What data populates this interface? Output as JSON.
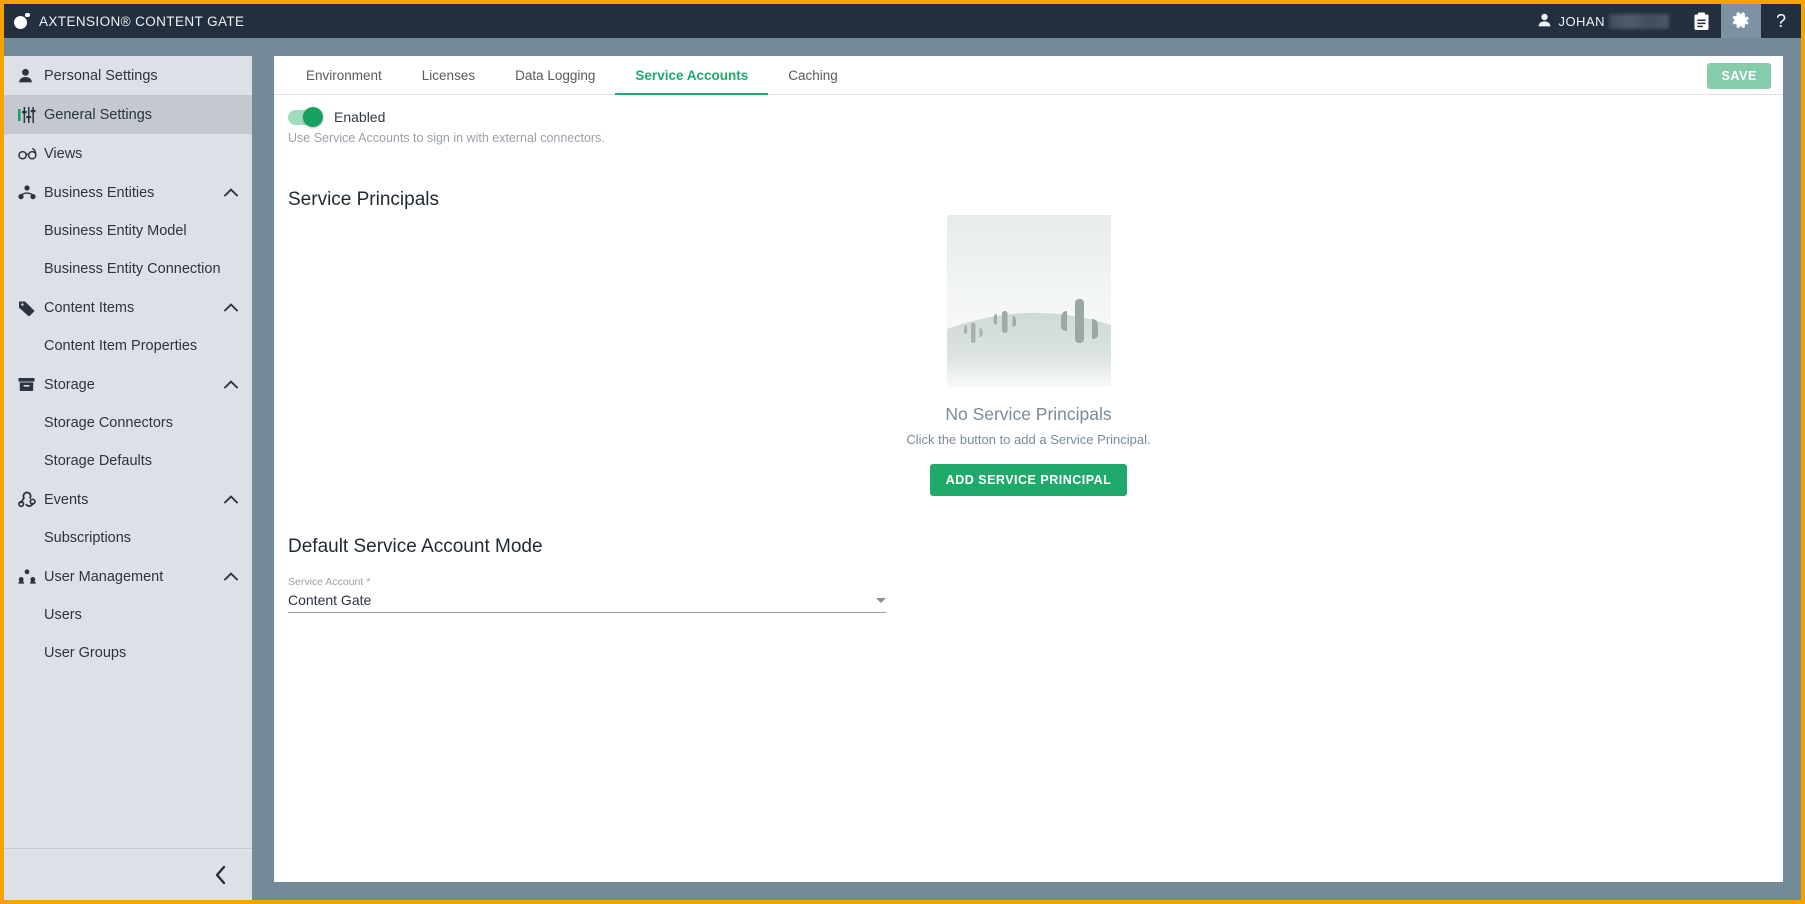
{
  "app": {
    "title": "AXTENSION® CONTENT GATE",
    "brand_icon": "axtension-logo-icon",
    "accent_green": "#1faa6c",
    "topbar_bg": "#232f3e",
    "frame_border": "#F5A300",
    "page_bg": "#738b99"
  },
  "topbar": {
    "user": {
      "icon": "user-icon",
      "name": "JOHAN",
      "name_redacted": true
    },
    "icons": [
      {
        "name": "clipboard-icon",
        "label": "Clipboard"
      },
      {
        "name": "gear-icon",
        "label": "Settings",
        "active": true
      },
      {
        "name": "help-icon",
        "label": "Help"
      }
    ]
  },
  "sidebar": {
    "items": [
      {
        "label": "Personal Settings",
        "icon": "user-icon",
        "type": "item",
        "selected": false,
        "expandable": false
      },
      {
        "label": "General Settings",
        "icon": "sliders-icon",
        "type": "item",
        "selected": true,
        "expandable": false
      },
      {
        "label": "Views",
        "icon": "glasses-icon",
        "type": "item",
        "selected": false,
        "expandable": false
      },
      {
        "label": "Business Entities",
        "icon": "hierarchy-icon",
        "type": "group",
        "expandable": true,
        "expanded": true
      },
      {
        "label": "Business Entity Model",
        "type": "sub"
      },
      {
        "label": "Business Entity Connection",
        "type": "sub"
      },
      {
        "label": "Content Items",
        "icon": "tag-icon",
        "type": "group",
        "expandable": true,
        "expanded": true
      },
      {
        "label": "Content Item Properties",
        "type": "sub"
      },
      {
        "label": "Storage",
        "icon": "archive-icon",
        "type": "group",
        "expandable": true,
        "expanded": true
      },
      {
        "label": "Storage Connectors",
        "type": "sub"
      },
      {
        "label": "Storage Defaults",
        "type": "sub"
      },
      {
        "label": "Events",
        "icon": "webhook-icon",
        "type": "group",
        "expandable": true,
        "expanded": true
      },
      {
        "label": "Subscriptions",
        "type": "sub"
      },
      {
        "label": "User Management",
        "icon": "users-icon",
        "type": "group",
        "expandable": true,
        "expanded": true
      },
      {
        "label": "Users",
        "type": "sub"
      },
      {
        "label": "User Groups",
        "type": "sub"
      }
    ],
    "collapse_icon": "chevron-left-icon"
  },
  "main": {
    "tabs": [
      {
        "label": "Environment",
        "active": false
      },
      {
        "label": "Licenses",
        "active": false
      },
      {
        "label": "Data Logging",
        "active": false
      },
      {
        "label": "Service Accounts",
        "active": true
      },
      {
        "label": "Caching",
        "active": false
      }
    ],
    "save_label": "SAVE",
    "toggle": {
      "label": "Enabled",
      "enabled": true,
      "description": "Use Service Accounts to sign in with external connectors."
    },
    "service_principals": {
      "heading": "Service Principals",
      "empty_illustration": "desert-cactus-illustration",
      "empty_title": "No Service Principals",
      "empty_subtitle": "Click the button to add a Service Principal.",
      "add_button_label": "ADD SERVICE PRINCIPAL"
    },
    "default_mode": {
      "heading": "Default Service Account Mode",
      "field_label": "Service Account *",
      "field_value": "Content Gate",
      "dropdown_icon": "chevron-down-icon"
    }
  }
}
